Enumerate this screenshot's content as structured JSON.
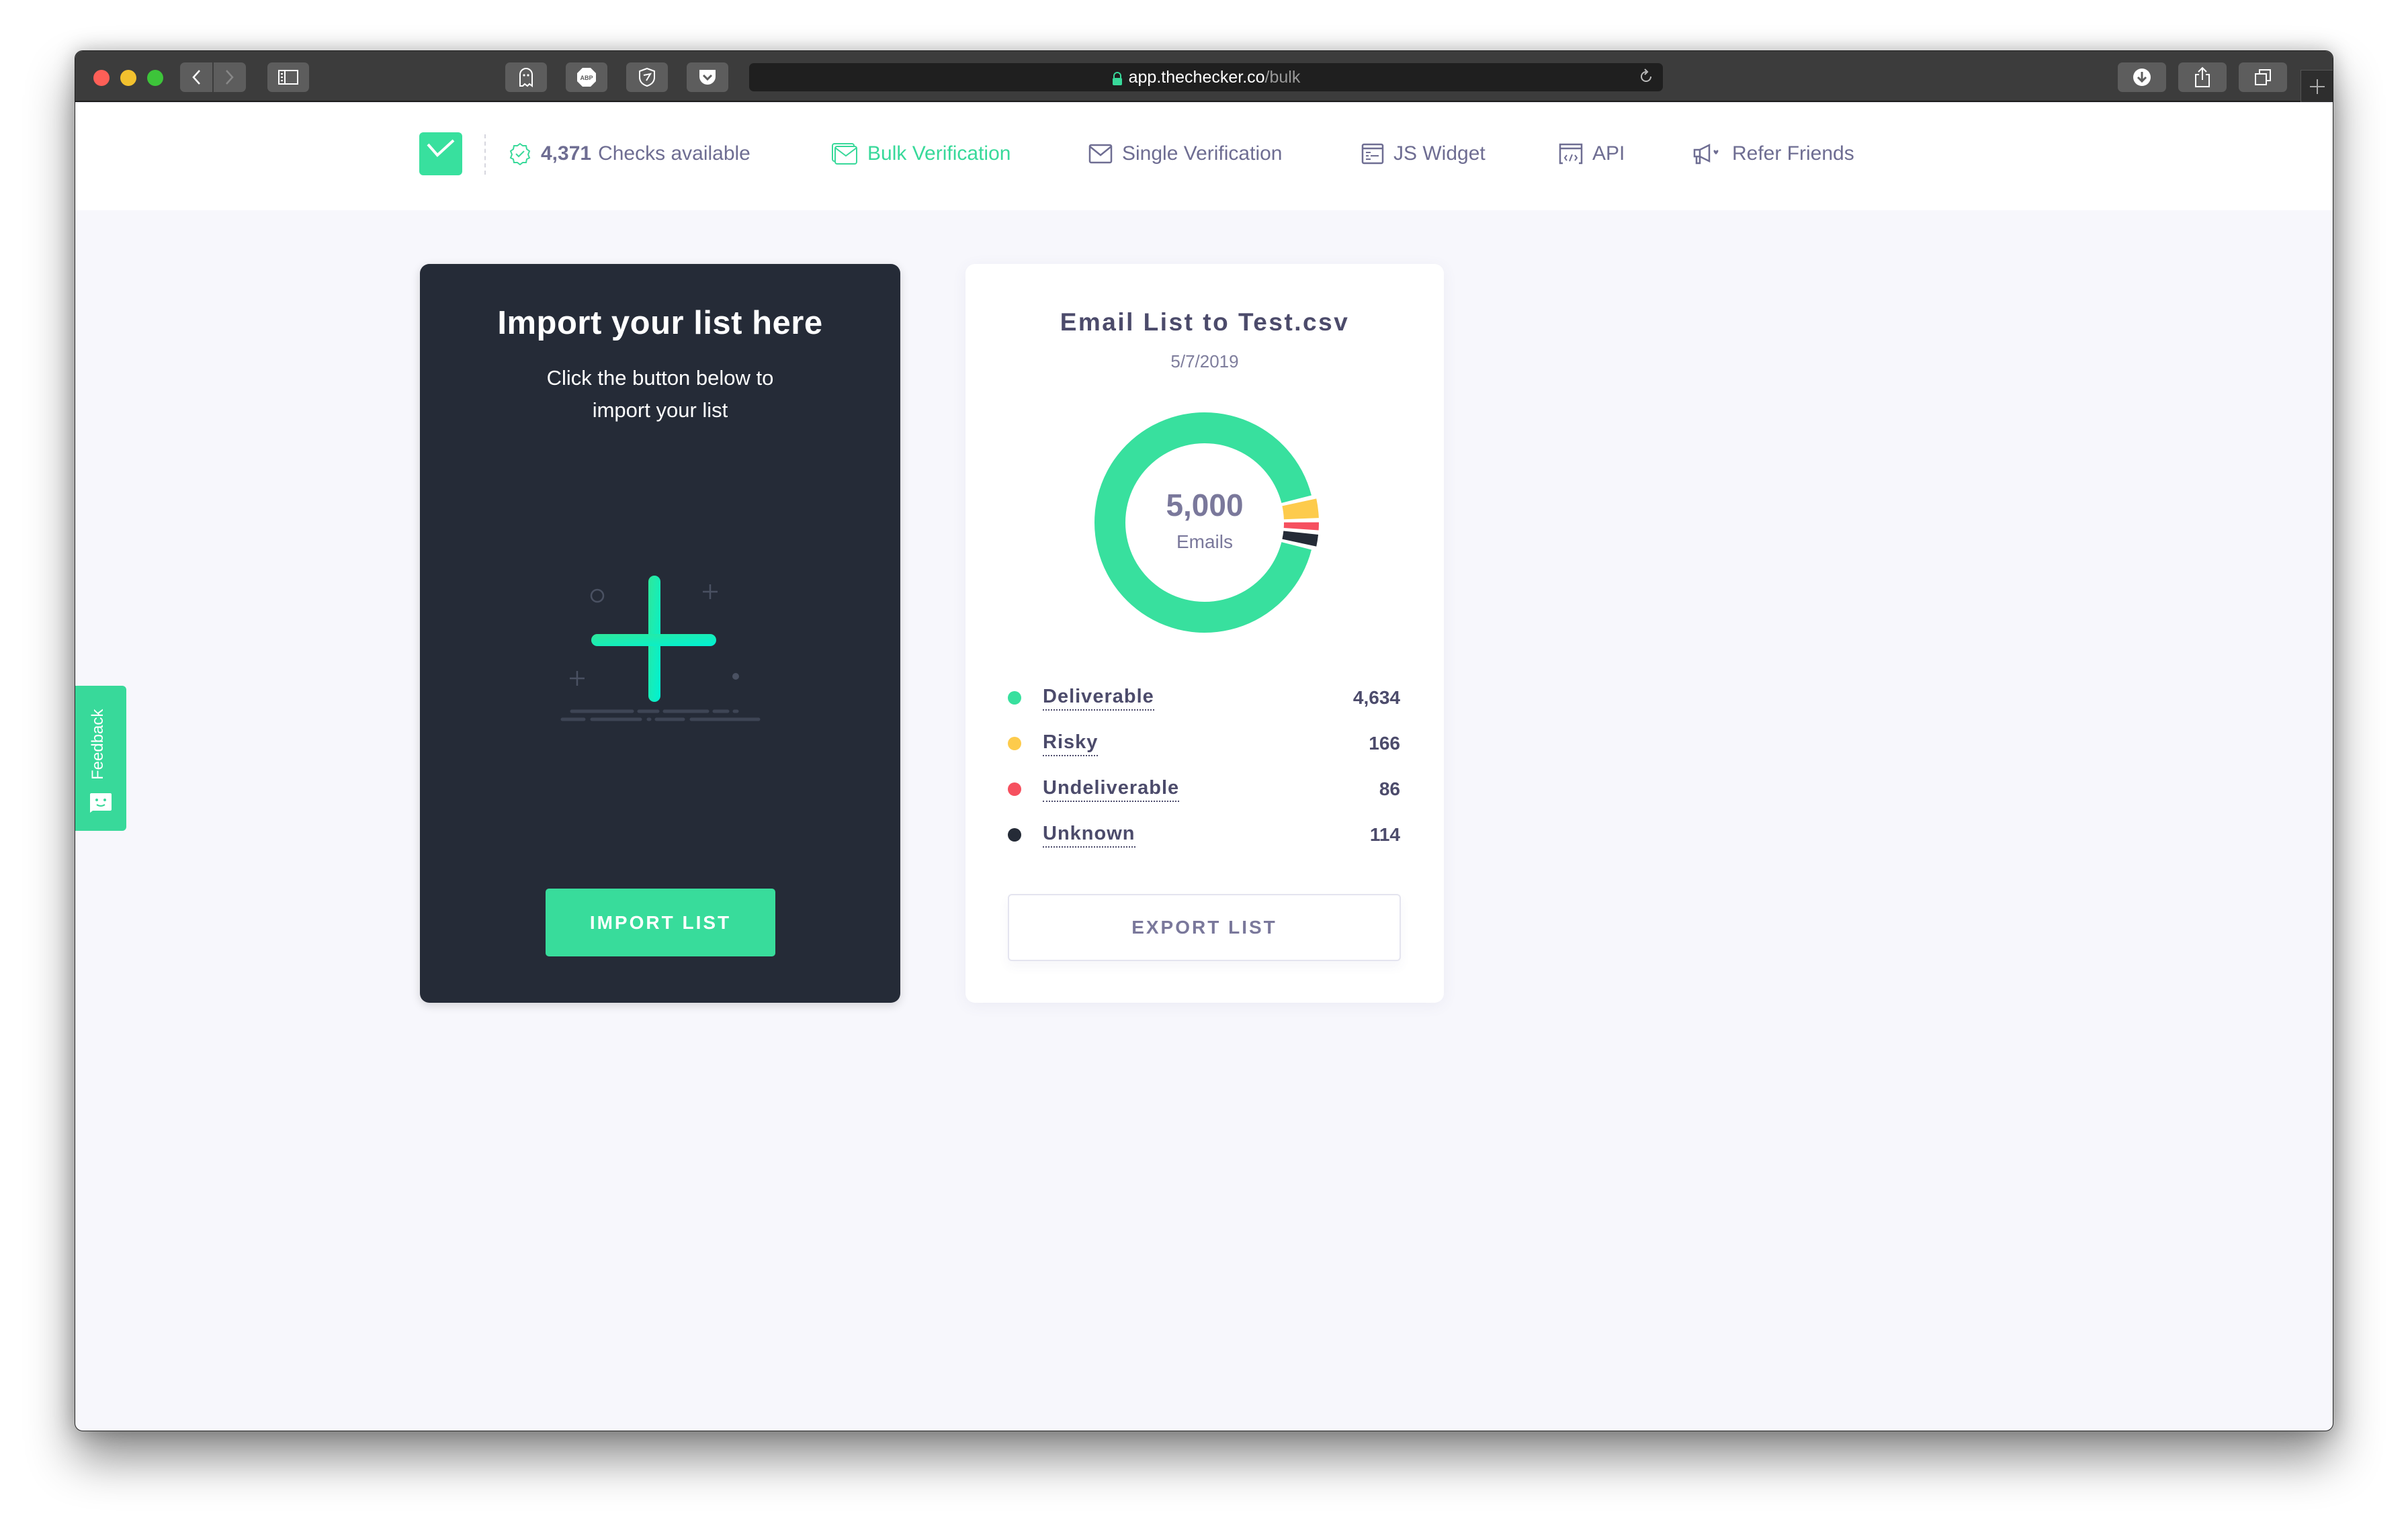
{
  "browser": {
    "url_host": "app.thechecker.co",
    "url_path": "/bulk",
    "toolbar_icons": [
      "back-icon",
      "forward-icon",
      "sidebar-icon",
      "ghostery-icon",
      "adblock-plus-icon",
      "privacy-badger-icon",
      "pocket-icon",
      "download-icon",
      "share-icon",
      "tabs-icon",
      "new-tab-icon"
    ],
    "abp_label": "ABP"
  },
  "header": {
    "checks_count": "4,371",
    "checks_label": "Checks available",
    "nav": [
      {
        "label": "Bulk Verification",
        "icon": "mail-stack-icon",
        "active": true
      },
      {
        "label": "Single Verification",
        "icon": "mail-icon",
        "active": false
      },
      {
        "label": "JS Widget",
        "icon": "widget-icon",
        "active": false
      },
      {
        "label": "API",
        "icon": "code-window-icon",
        "active": false
      },
      {
        "label": "Refer Friends",
        "icon": "megaphone-icon",
        "active": false
      }
    ]
  },
  "import_card": {
    "title": "Import your list here",
    "description": "Click the button below to import your list",
    "button_label": "IMPORT LIST"
  },
  "results_card": {
    "title": "Email List to Test.csv",
    "date": "5/7/2019",
    "total": "5,000",
    "total_label": "Emails",
    "export_label": "EXPORT LIST"
  },
  "chart_data": {
    "type": "pie",
    "title": "Email List to Test.csv",
    "center_label": "5,000 Emails",
    "categories": [
      "Deliverable",
      "Risky",
      "Undeliverable",
      "Unknown"
    ],
    "values": [
      4634,
      166,
      86,
      114
    ],
    "display_values": [
      "4,634",
      "166",
      "86",
      "114"
    ],
    "colors": [
      "#38e09e",
      "#fdcb4c",
      "#f6505f",
      "#252b37"
    ],
    "legend": "bottom"
  },
  "feedback": {
    "label": "Feedback"
  }
}
